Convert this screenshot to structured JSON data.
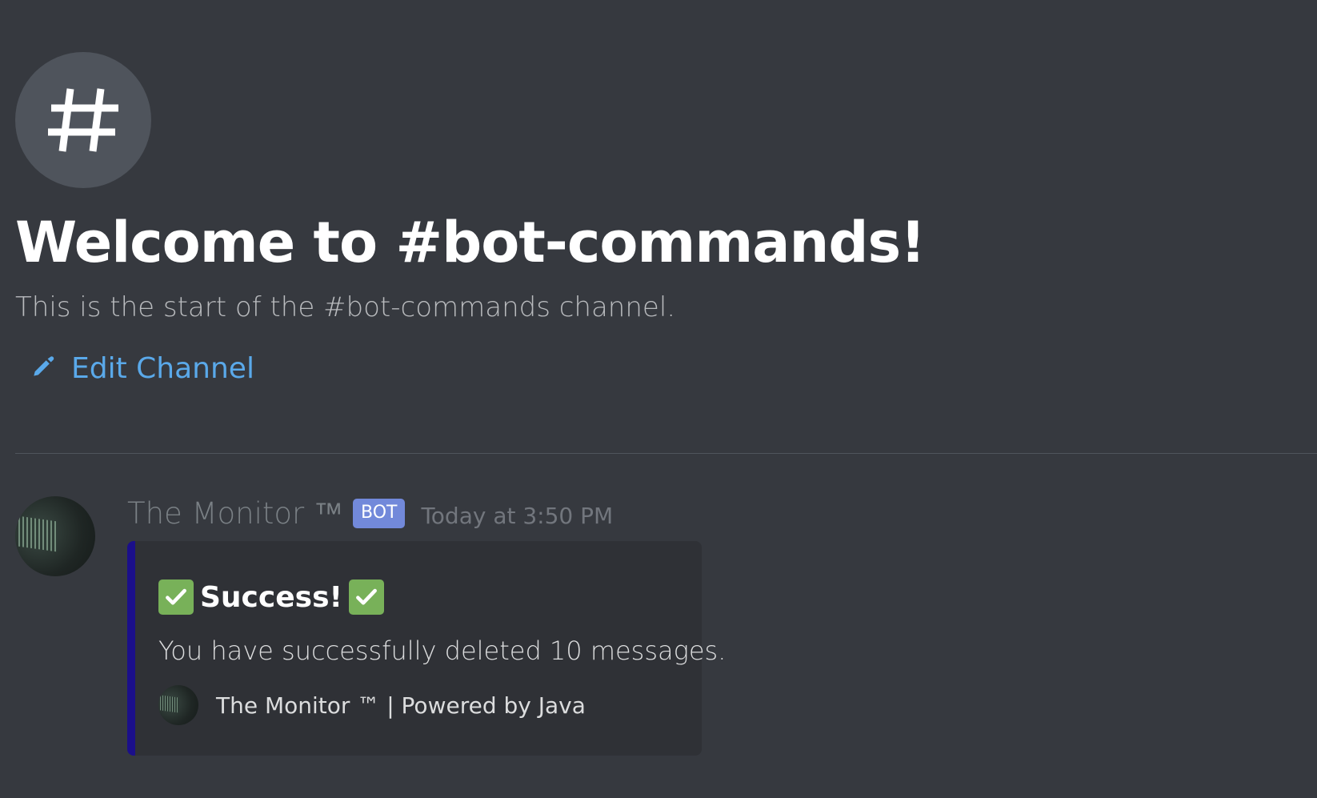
{
  "welcome": {
    "icon": "hash-icon",
    "title": "Welcome to #bot-commands!",
    "subtitle": "This is the start of the #bot-commands channel.",
    "edit_label": "Edit Channel",
    "edit_icon": "pencil-icon"
  },
  "message": {
    "author": "The Monitor ™",
    "badge": "BOT",
    "timestamp": "Today at 3:50 PM",
    "avatar_icon": "bot-avatar",
    "embed": {
      "accent_color": "#1b0f8a",
      "title": "Success!",
      "title_icon": "check-mark-icon",
      "description": "You have successfully deleted 10 messages.",
      "footer": "The Monitor ™ | Powered by Java"
    }
  },
  "colors": {
    "background": "#36393f",
    "embed_background": "#2f3136",
    "link": "#5aa9ea",
    "bot_badge": "#7289da",
    "check_green": "#78b159"
  }
}
